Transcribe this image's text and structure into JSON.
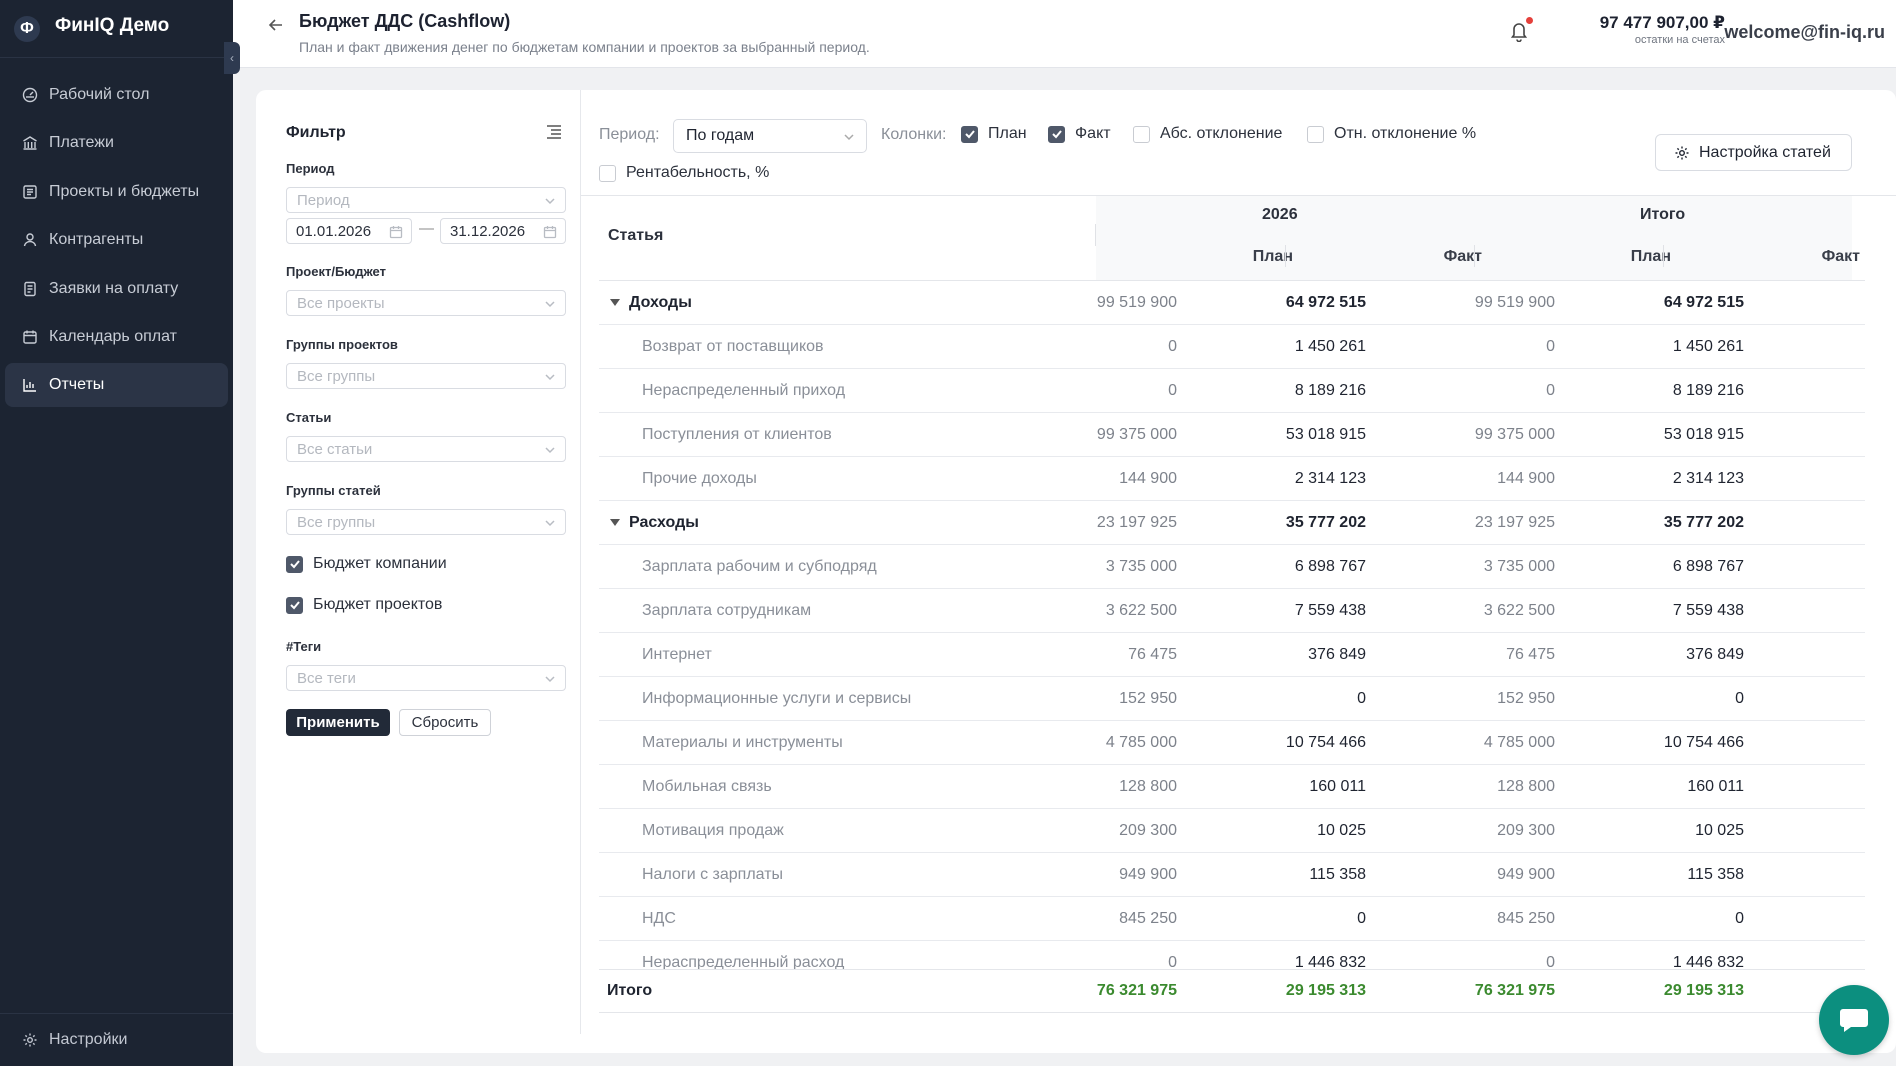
{
  "brand": {
    "logo": "Ф",
    "name": "ФинIQ Демо"
  },
  "sidebar": {
    "items": [
      {
        "label": "Рабочий стол",
        "icon": "dashboard-icon"
      },
      {
        "label": "Платежи",
        "icon": "bank-icon"
      },
      {
        "label": "Проекты и бюджеты",
        "icon": "projects-icon"
      },
      {
        "label": "Контрагенты",
        "icon": "contacts-icon"
      },
      {
        "label": "Заявки на оплату",
        "icon": "requests-icon"
      },
      {
        "label": "Календарь оплат",
        "icon": "calendar-icon"
      },
      {
        "label": "Отчеты",
        "icon": "chart-icon",
        "active": true
      }
    ],
    "settings_label": "Настройки"
  },
  "header": {
    "title": "Бюджет ДДС (Cashflow)",
    "subtitle": "План и факт движения денег по бюджетам компании и проектов за выбранный период.",
    "balance_value": "97 477 907,00 ₽",
    "balance_label": "остатки на счетах",
    "user_email": "welcome@fin-iq.ru"
  },
  "filter": {
    "title": "Фильтр",
    "period_label": "Период",
    "period_placeholder": "Период",
    "date_from": "01.01.2026",
    "date_to": "31.12.2026",
    "date_separator": "—",
    "project_label": "Проект/Бюджет",
    "project_placeholder": "Все проекты",
    "project_groups_label": "Группы проектов",
    "project_groups_placeholder": "Все группы",
    "articles_label": "Статьи",
    "articles_placeholder": "Все статьи",
    "article_groups_label": "Группы статей",
    "article_groups_placeholder": "Все группы",
    "company_budget_label": "Бюджет компании",
    "company_budget_checked": true,
    "project_budget_label": "Бюджет проектов",
    "project_budget_checked": true,
    "tags_label": "#Теги",
    "tags_placeholder": "Все теги",
    "apply_label": "Применить",
    "reset_label": "Сбросить"
  },
  "toolbar": {
    "period_label": "Период:",
    "period_value": "По годам",
    "columns_label": "Колонки:",
    "col_plan": "План",
    "col_plan_checked": true,
    "col_fact": "Факт",
    "col_fact_checked": true,
    "col_abs": "Абс. отклонение",
    "col_abs_checked": false,
    "col_rel": "Отн. отклонение %",
    "col_rel_checked": false,
    "col_profit": "Рентабельность, %",
    "col_profit_checked": false,
    "settings_label": "Настройка статей"
  },
  "table": {
    "article_header": "Статья",
    "year_header": "2026",
    "total_header": "Итого",
    "plan_header": "План",
    "fact_header": "Факт",
    "rows": [
      {
        "name": "Доходы",
        "group": true,
        "v": [
          "99 519 900",
          "64 972 515",
          "99 519 900",
          "64 972 515"
        ]
      },
      {
        "name": "Возврат от поставщиков",
        "v": [
          "0",
          "1 450 261",
          "0",
          "1 450 261"
        ]
      },
      {
        "name": "Нераспределенный приход",
        "v": [
          "0",
          "8 189 216",
          "0",
          "8 189 216"
        ]
      },
      {
        "name": "Поступления от клиентов",
        "v": [
          "99 375 000",
          "53 018 915",
          "99 375 000",
          "53 018 915"
        ]
      },
      {
        "name": "Прочие доходы",
        "v": [
          "144 900",
          "2 314 123",
          "144 900",
          "2 314 123"
        ]
      },
      {
        "name": "Расходы",
        "group": true,
        "v": [
          "23 197 925",
          "35 777 202",
          "23 197 925",
          "35 777 202"
        ]
      },
      {
        "name": "Зарплата рабочим и субподряд",
        "v": [
          "3 735 000",
          "6 898 767",
          "3 735 000",
          "6 898 767"
        ]
      },
      {
        "name": "Зарплата сотрудникам",
        "v": [
          "3 622 500",
          "7 559 438",
          "3 622 500",
          "7 559 438"
        ]
      },
      {
        "name": "Интернет",
        "v": [
          "76 475",
          "376 849",
          "76 475",
          "376 849"
        ]
      },
      {
        "name": "Информационные услуги и сервисы",
        "v": [
          "152 950",
          "0",
          "152 950",
          "0"
        ]
      },
      {
        "name": "Материалы и инструменты",
        "v": [
          "4 785 000",
          "10 754 466",
          "4 785 000",
          "10 754 466"
        ]
      },
      {
        "name": "Мобильная связь",
        "v": [
          "128 800",
          "160 011",
          "128 800",
          "160 011"
        ]
      },
      {
        "name": "Мотивация продаж",
        "v": [
          "209 300",
          "10 025",
          "209 300",
          "10 025"
        ]
      },
      {
        "name": "Налоги с зарплаты",
        "v": [
          "949 900",
          "115 358",
          "949 900",
          "115 358"
        ]
      },
      {
        "name": "НДС",
        "v": [
          "845 250",
          "0",
          "845 250",
          "0"
        ]
      },
      {
        "name": "Нераспределенный расход",
        "v": [
          "0",
          "1 446 832",
          "0",
          "1 446 832"
        ]
      }
    ],
    "total": {
      "label": "Итого",
      "v": [
        "76 321 975",
        "29 195 313",
        "76 321 975",
        "29 195 313"
      ]
    }
  },
  "colors": {
    "sidebar_bg": "#1c2432",
    "accent_green": "#3b8a2f",
    "chat_btn": "#0c8f7f"
  }
}
